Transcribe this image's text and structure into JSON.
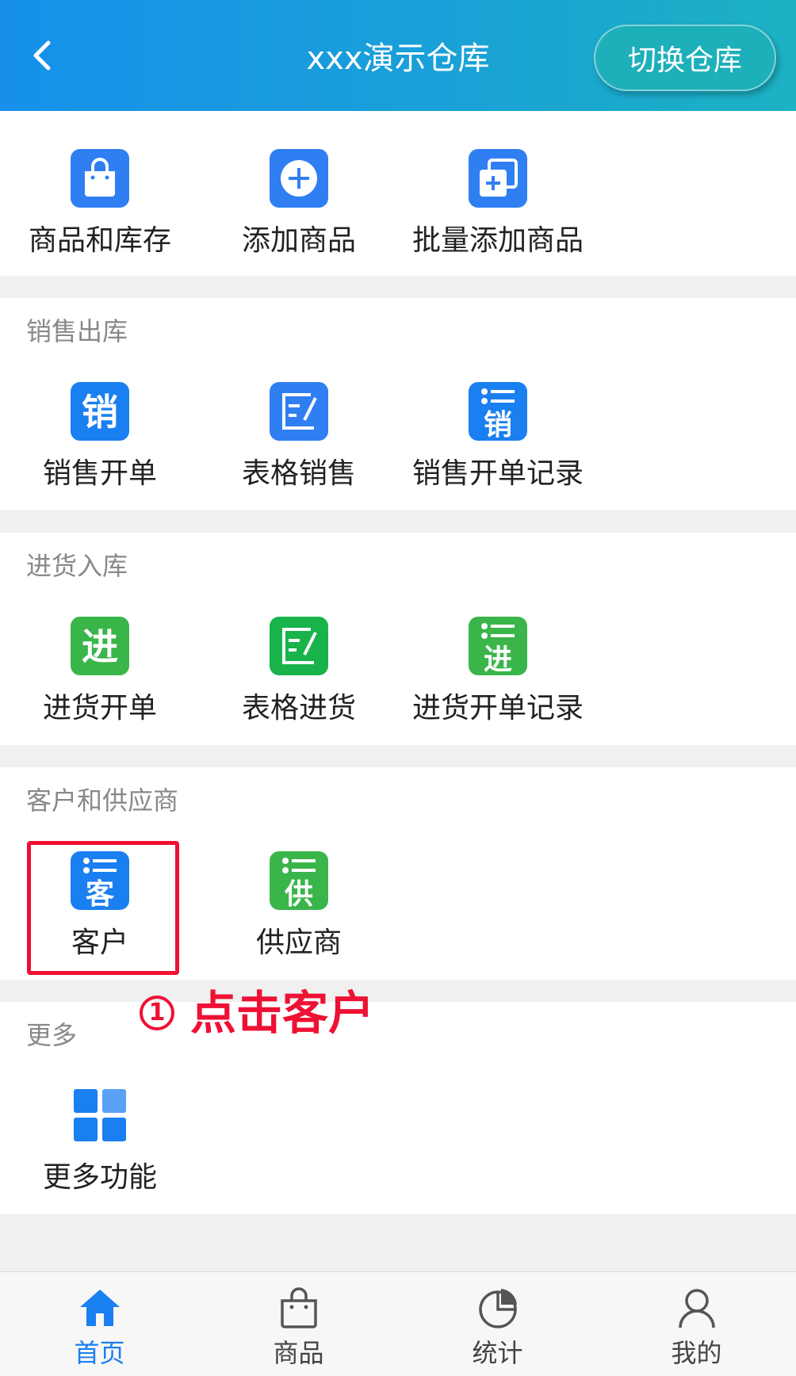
{
  "header": {
    "title": "xxx演示仓库",
    "switch_label": "切换仓库"
  },
  "top_section": {
    "items": [
      {
        "label": "商品和库存",
        "icon": "shopping-bag-icon",
        "color": "#2f7ff2"
      },
      {
        "label": "添加商品",
        "icon": "plus-circle-icon",
        "color": "#2f7ff2"
      },
      {
        "label": "批量添加商品",
        "icon": "batch-add-icon",
        "color": "#2f7ff2"
      }
    ]
  },
  "sales": {
    "title": "销售出库",
    "items": [
      {
        "label": "销售开单",
        "icon": "sales-order-icon",
        "glyph": "销",
        "color": "#1a7ff0"
      },
      {
        "label": "表格销售",
        "icon": "table-edit-icon",
        "color": "#2f7ff2"
      },
      {
        "label": "销售开单记录",
        "icon": "sales-record-icon",
        "glyph": "销",
        "color": "#1a7ff0"
      }
    ]
  },
  "purchase": {
    "title": "进货入库",
    "items": [
      {
        "label": "进货开单",
        "icon": "purchase-order-icon",
        "glyph": "进",
        "color": "#3ab54a"
      },
      {
        "label": "表格进货",
        "icon": "table-edit-icon",
        "color": "#18b34a"
      },
      {
        "label": "进货开单记录",
        "icon": "purchase-record-icon",
        "glyph": "进",
        "color": "#3ab54a"
      }
    ]
  },
  "partners": {
    "title": "客户和供应商",
    "items": [
      {
        "label": "客户",
        "icon": "customer-list-icon",
        "glyph": "客",
        "color": "#1a7ff0"
      },
      {
        "label": "供应商",
        "icon": "supplier-list-icon",
        "glyph": "供",
        "color": "#3ab54a"
      }
    ]
  },
  "annotation": {
    "number": "1",
    "text": "点击客户",
    "color": "#ee1133"
  },
  "more": {
    "title": "更多",
    "items": [
      {
        "label": "更多功能",
        "icon": "grid-apps-icon",
        "color": "#1a7ff0"
      }
    ]
  },
  "bottom_nav": {
    "items": [
      {
        "label": "首页",
        "icon": "home-icon",
        "active": true
      },
      {
        "label": "商品",
        "icon": "shopping-bag-icon",
        "active": false
      },
      {
        "label": "统计",
        "icon": "pie-chart-icon",
        "active": false
      },
      {
        "label": "我的",
        "icon": "user-icon",
        "active": false
      }
    ],
    "active_color": "#1a7ff0"
  }
}
